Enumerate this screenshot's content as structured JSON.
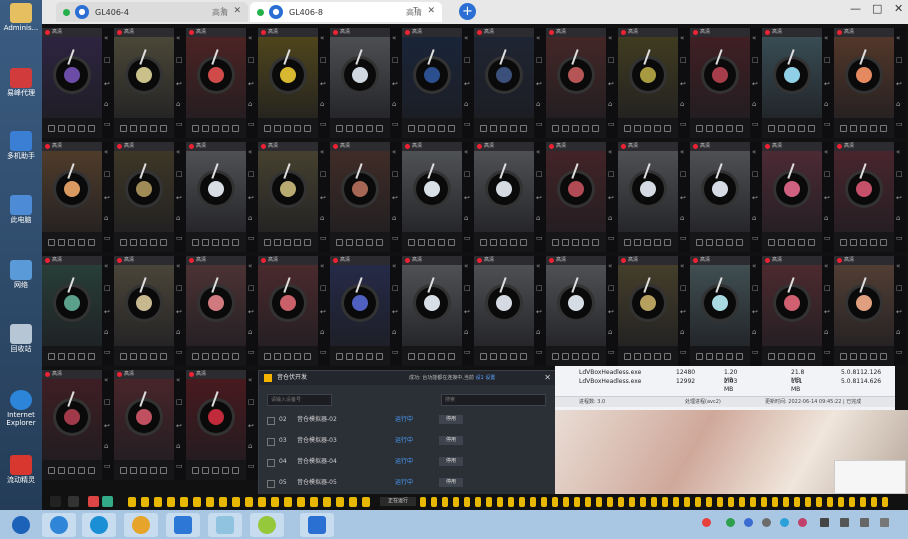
{
  "desktop_icons": [
    "Adminis...",
    "易峰代理",
    "多机助手",
    "此电脑",
    "网络",
    "回收站",
    "Internet Explorer",
    "流动精灵"
  ],
  "browser": {
    "tabs": [
      {
        "title": "GL406-4",
        "quality": "高清",
        "shortcut": "I"
      },
      {
        "title": "GL406-8",
        "quality": "高清",
        "shortcut": "T"
      }
    ],
    "phone_header": "高清",
    "window_controls": {
      "minimize": "—",
      "maximize": "□",
      "close": "✕"
    }
  },
  "phones": [
    {
      "c": "#6b4da8"
    },
    {
      "c": "#c9c08a"
    },
    {
      "c": "#d04a4a"
    },
    {
      "c": "#d7b830"
    },
    {
      "c": "#cfd7e0"
    },
    {
      "c": "#2b4f8f"
    },
    {
      "c": "#3a4f7a"
    },
    {
      "c": "#b65555"
    },
    {
      "c": "#a89a40"
    },
    {
      "c": "#a73d4a"
    },
    {
      "c": "#8fd0e6"
    },
    {
      "c": "#e58a60"
    },
    {
      "c": "#d89a60"
    },
    {
      "c": "#a08a55"
    },
    {
      "c": "#d8dde5"
    },
    {
      "c": "#b8aa70"
    },
    {
      "c": "#a56655"
    },
    {
      "c": "#d8e0e8"
    },
    {
      "c": "#d5dbe2"
    },
    {
      "c": "#b04a55"
    },
    {
      "c": "#d4dae3"
    },
    {
      "c": "#d5dbe4"
    },
    {
      "c": "#d06080"
    },
    {
      "c": "#c4506a"
    },
    {
      "c": "#5aa08a"
    },
    {
      "c": "#c8b890"
    },
    {
      "c": "#d07a80"
    },
    {
      "c": "#c9606a"
    },
    {
      "c": "#5060c0"
    },
    {
      "c": "#d8dee6"
    },
    {
      "c": "#d5dae2"
    },
    {
      "c": "#d6dce4"
    },
    {
      "c": "#b5a060"
    },
    {
      "c": "#a8d8e0"
    },
    {
      "c": "#d06070"
    },
    {
      "c": "#e0a080"
    },
    {
      "c": "#a03a4a"
    },
    {
      "c": "#c05060"
    },
    {
      "c": "#c02a3a"
    }
  ],
  "dialog": {
    "title": "音仓伏开发",
    "status": "成功: 台功能都在连接中,当前",
    "status_link": "设1 设置",
    "search_placeholder": "请输入设备号",
    "search2_placeholder": "搜索",
    "rows": [
      {
        "num": "02",
        "name": "音仓模拟器-02",
        "status": "运行中",
        "btn": "停用"
      },
      {
        "num": "03",
        "name": "音仓模拟器-03",
        "status": "运行中",
        "btn": "停用"
      },
      {
        "num": "04",
        "name": "音仓模拟器-04",
        "status": "运行中",
        "btn": "停用"
      },
      {
        "num": "05",
        "name": "音仓模拟器-05",
        "status": "运行中",
        "btn": "停用"
      }
    ]
  },
  "file_manager": {
    "rows": [
      {
        "name": "LdVBoxHeadless.exe",
        "pid": "12480",
        "cpu": "1.20 MB",
        "mem": "21.8 MB",
        "date": "5.0.8112.126"
      },
      {
        "name": "LdVBoxHeadless.exe",
        "pid": "12992",
        "cpu": "2.03 MB",
        "mem": "111 MB",
        "date": "5.0.8114.626"
      }
    ],
    "status_left": "进程数: 3.0",
    "status_mid": "处理进程(avc2)",
    "status_right": "更新时间: 2022-06-14 09:45:22 | 已完成"
  },
  "strip_label": "正在运行",
  "taskbar": {
    "apps": [
      "start",
      "search-s",
      "edge",
      "chrome",
      "tool",
      "explorer",
      "leaf",
      "phone"
    ],
    "tray_colors": [
      "#e8413c",
      "#2e9f4a",
      "#3a6cd1",
      "#6c6c6c",
      "#2aa1d8",
      "#c03f6b"
    ]
  }
}
